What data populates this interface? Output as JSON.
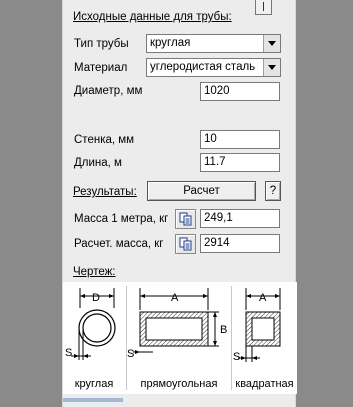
{
  "header": {
    "title": "Исходные данные для трубы:"
  },
  "inputs": {
    "pipe_type": {
      "label": "Тип трубы",
      "value": "круглая"
    },
    "material": {
      "label": "Материал",
      "value": "углеродистая сталь"
    },
    "diameter": {
      "label": "Диаметр, мм",
      "value": "1020"
    },
    "wall": {
      "label": "Стенка, мм",
      "value": "10"
    },
    "length": {
      "label": "Длина, м",
      "value": "11.7"
    }
  },
  "results": {
    "title": "Результаты:",
    "calc_button": "Расчет",
    "help_button": "?",
    "mass_per_meter": {
      "label": "Масса 1 метра, кг",
      "value": "249,1"
    },
    "calc_mass": {
      "label": "Расчет. масса, кг",
      "value": "2914"
    }
  },
  "drawing": {
    "title": "Чертеж:",
    "items": [
      {
        "caption": "круглая",
        "dims": [
          "D",
          "S"
        ]
      },
      {
        "caption": "прямоугольная",
        "dims": [
          "A",
          "B",
          "S"
        ]
      },
      {
        "caption": "квадратная",
        "dims": [
          "A",
          "S"
        ]
      }
    ]
  }
}
